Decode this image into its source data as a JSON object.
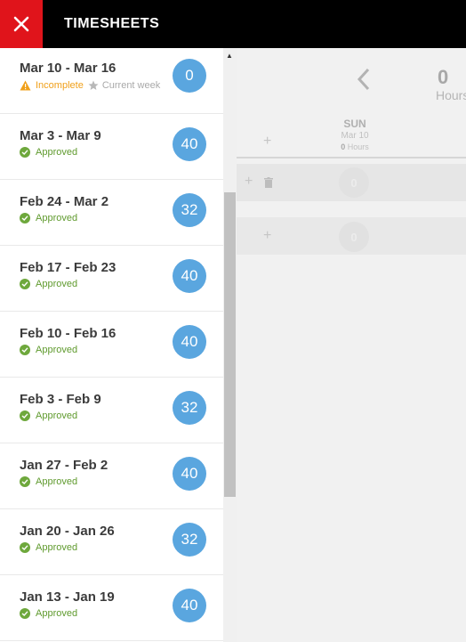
{
  "header": {
    "title": "TIMESHEETS",
    "close_icon": "close-icon"
  },
  "main": {
    "hours_value": "0",
    "hours_label": "Hours",
    "day": {
      "name": "SUN",
      "date": "Mar 10",
      "hours_value": "0",
      "hours_unit": "Hours"
    },
    "entry_value": "0",
    "entry2_value": "0",
    "plus_symbol": "+"
  },
  "weeks": [
    {
      "range": "Mar 10 - Mar 16",
      "status": "Incomplete",
      "extra": "Current week",
      "hours": "0"
    },
    {
      "range": "Mar 3 - Mar 9",
      "status": "Approved",
      "hours": "40"
    },
    {
      "range": "Feb 24 - Mar 2",
      "status": "Approved",
      "hours": "32"
    },
    {
      "range": "Feb 17 - Feb 23",
      "status": "Approved",
      "hours": "40"
    },
    {
      "range": "Feb 10 - Feb 16",
      "status": "Approved",
      "hours": "40"
    },
    {
      "range": "Feb 3 - Feb 9",
      "status": "Approved",
      "hours": "32"
    },
    {
      "range": "Jan 27 - Feb 2",
      "status": "Approved",
      "hours": "40"
    },
    {
      "range": "Jan 20 - Jan 26",
      "status": "Approved",
      "hours": "32"
    },
    {
      "range": "Jan 13 - Jan 19",
      "status": "Approved",
      "hours": "40"
    }
  ],
  "colors": {
    "close_bg": "#e0141b",
    "header_bg": "#000000",
    "hours_badge": "#5aa6df",
    "approved": "#5f9a2d",
    "incomplete": "#f0a01a"
  }
}
